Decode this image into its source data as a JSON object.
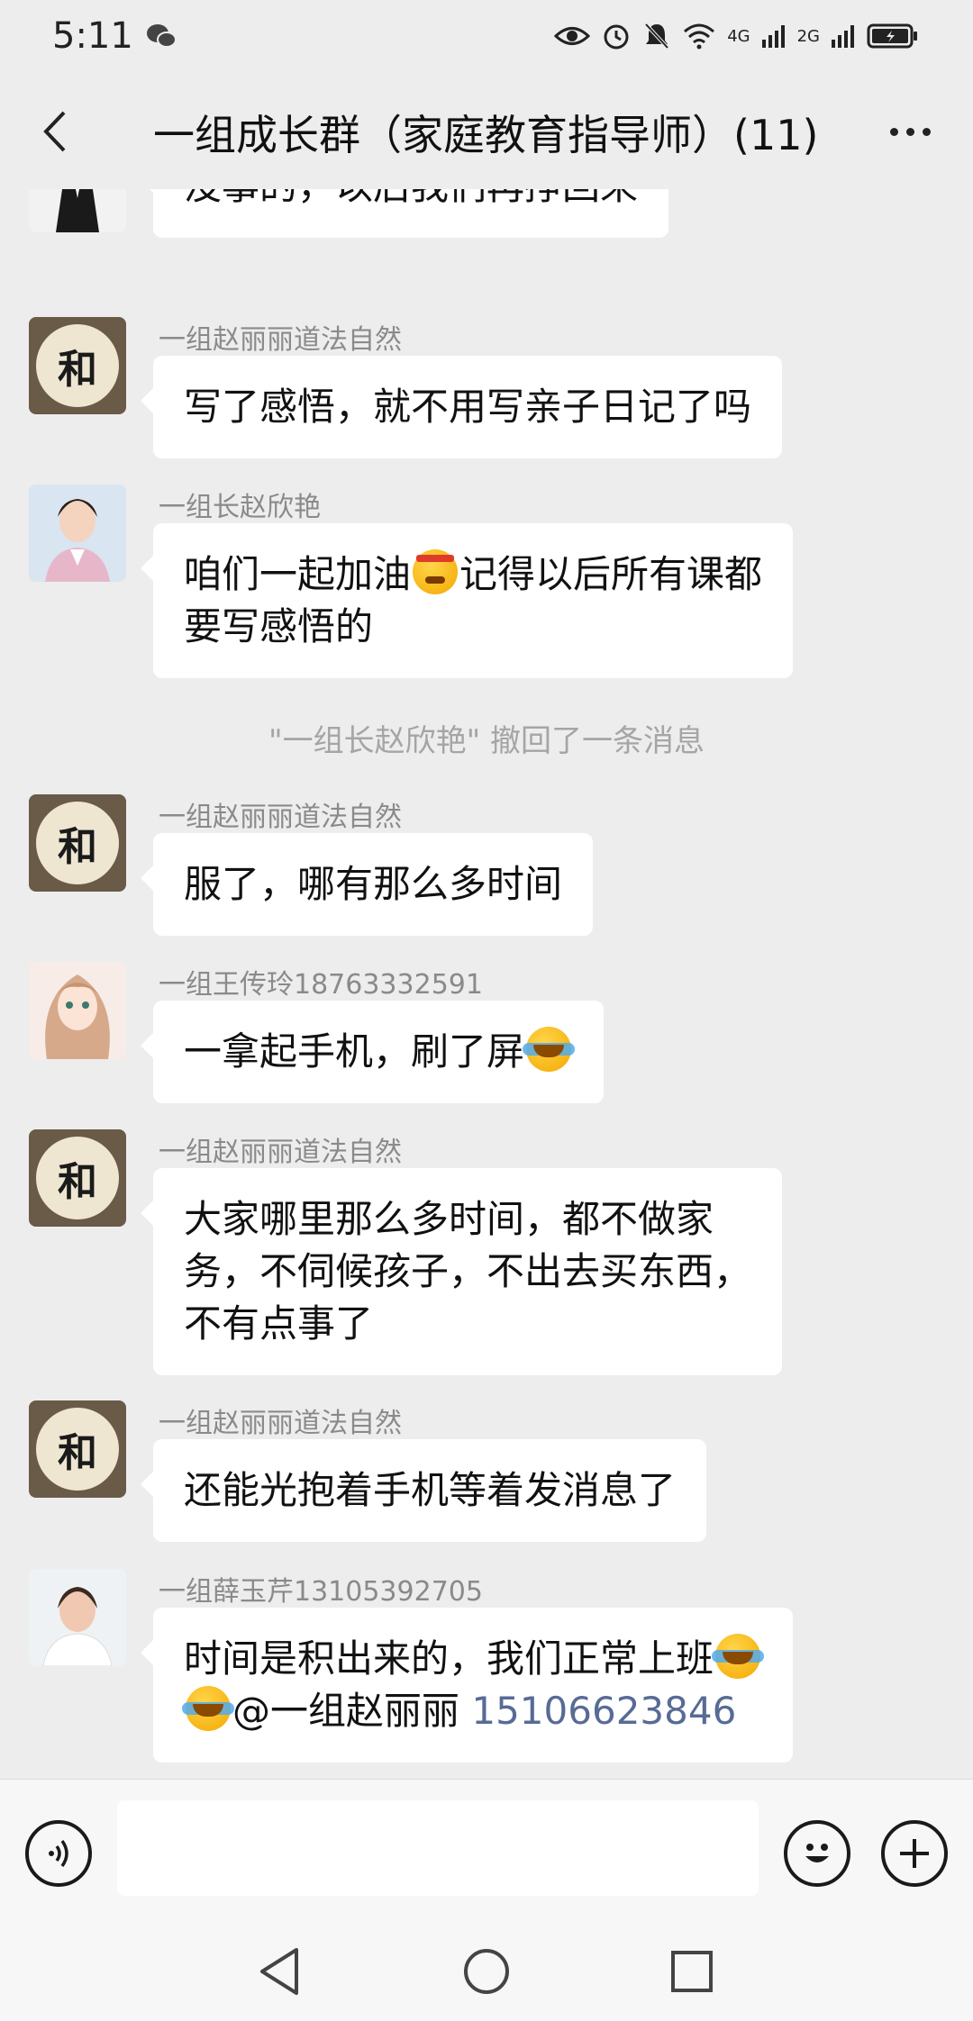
{
  "status_bar": {
    "time": "5:11",
    "network_label_1": "4G",
    "network_label_2": "2G"
  },
  "header": {
    "title": "一组成长群（家庭教育指导师）(11)"
  },
  "messages": [
    {
      "sender": "",
      "text": "没事的，以后我们再挣回来"
    },
    {
      "sender": "一组赵丽丽道法自然",
      "text": "写了感悟，就不用写亲子日记了吗"
    },
    {
      "sender": "一组长赵欣艳",
      "text_1": "咱们一起加油",
      "text_2": "记得以后所有课都",
      "text_3": "要写感悟的"
    },
    {
      "system": "\"一组长赵欣艳\" 撤回了一条消息"
    },
    {
      "sender": "一组赵丽丽道法自然",
      "text": "服了，哪有那么多时间"
    },
    {
      "sender": "一组王传玲18763332591",
      "text": "一拿起手机，刷了屏"
    },
    {
      "sender": "一组赵丽丽道法自然",
      "line_1": "大家哪里那么多时间，都不做家",
      "line_2": "务，不伺候孩子，不出去买东西，",
      "line_3": "不有点事了"
    },
    {
      "sender": "一组赵丽丽道法自然",
      "text": "还能光抱着手机等着发消息了"
    },
    {
      "sender": "一组薛玉芹13105392705",
      "line_1": "时间是积出来的，我们正常上班",
      "mention": "@一组赵丽丽 ",
      "phone": "15106623846"
    }
  ],
  "avatar_glyph": "和",
  "input": {
    "placeholder": ""
  },
  "colors": {
    "background": "#ededed",
    "bubble": "#ffffff",
    "link": "#576b95"
  },
  "icons": [
    "back-arrow-icon",
    "more-icon",
    "voice-icon",
    "emoji-icon",
    "plus-icon",
    "eye-icon",
    "alarm-icon",
    "mute-icon",
    "wifi-icon",
    "signal-icon",
    "battery-icon"
  ]
}
